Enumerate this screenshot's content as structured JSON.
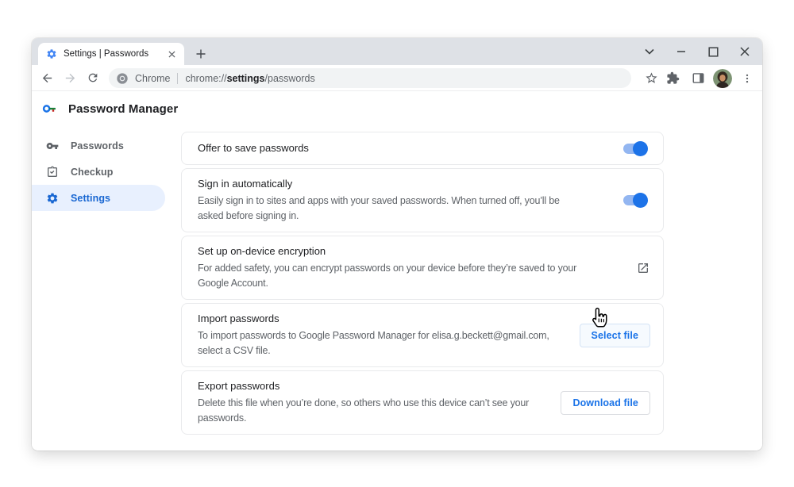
{
  "colors": {
    "accent_blue": "#1A73E8",
    "selected_nav_blue": "#1967D2",
    "selected_nav_bg": "#E8F0FE",
    "toggle_track": "#93B6F1",
    "toggle_knob": "#1D73E8",
    "tabstrip_bg": "#DEE1E6",
    "omnibox_bg": "#F1F3F4",
    "text_primary": "#202124",
    "text_secondary": "#5F6368"
  },
  "window": {
    "tab": {
      "title": "Settings | Passwords",
      "favicon": "settings-gear-icon"
    },
    "controls": [
      "chevron-down",
      "minimize",
      "maximize",
      "close"
    ]
  },
  "toolbar": {
    "nav_icons": [
      "back-arrow",
      "forward-arrow",
      "reload"
    ],
    "origin_label": "Chrome",
    "url_scheme": "chrome://",
    "url_bold": "settings",
    "url_rest": "/passwords",
    "right_icons": [
      "bookmark-star",
      "extensions-puzzle",
      "side-panel",
      "profile-avatar",
      "three-dot-menu"
    ]
  },
  "sidebar": {
    "title": "Password Manager",
    "logo": "password-manager-key-logo",
    "items": [
      {
        "label": "Passwords",
        "icon": "key-icon",
        "selected": false
      },
      {
        "label": "Checkup",
        "icon": "checkup-clipboard-icon",
        "selected": false
      },
      {
        "label": "Settings",
        "icon": "gear-icon",
        "selected": true
      }
    ]
  },
  "settings": {
    "rows": [
      {
        "title": "Offer to save passwords",
        "control": "toggle",
        "toggle_on": true
      },
      {
        "title": "Sign in automatically",
        "subtitle": "Easily sign in to sites and apps with your saved passwords. When turned off, you’ll be asked before signing in.",
        "control": "toggle",
        "toggle_on": true
      },
      {
        "title": "Set up on-device encryption",
        "subtitle": "For added safety, you can encrypt passwords on your device before they’re saved to your Google Account.",
        "control": "external-link-icon"
      },
      {
        "title": "Import passwords",
        "subtitle": "To import passwords to Google Password Manager for elisa.g.beckett@gmail.com, select a CSV file.",
        "control": "button",
        "button_label": "Select file",
        "hovered": true
      },
      {
        "title": "Export passwords",
        "subtitle": "Delete this file when you’re done, so others who use this device can’t see your passwords.",
        "control": "button",
        "button_label": "Download file",
        "hovered": false
      }
    ]
  },
  "cursor": "hand-pointer"
}
